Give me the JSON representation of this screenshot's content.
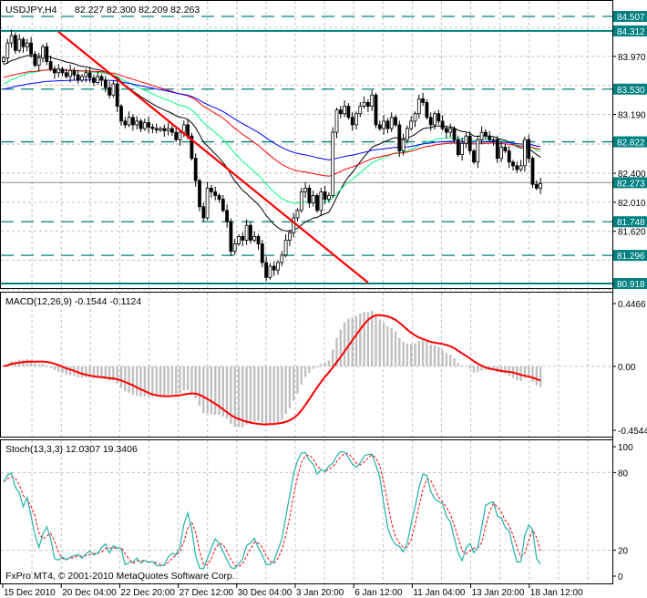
{
  "chart_data": [
    {
      "type": "candlestick",
      "title": "USDJPY,H4",
      "header_values": "82.227 82.300 82.209 82.263",
      "ylim": [
        80.8,
        84.62
      ],
      "closes": [
        83.95,
        84.15,
        84.25,
        84.05,
        84.2,
        84.1,
        84.15,
        84.0,
        83.85,
        83.95,
        84.1,
        83.9,
        83.8,
        83.75,
        83.8,
        83.75,
        83.7,
        83.78,
        83.72,
        83.65,
        83.7,
        83.75,
        83.68,
        83.62,
        83.7,
        83.65,
        83.55,
        83.45,
        83.6,
        83.3,
        83.1,
        83.05,
        83.15,
        83.05,
        83.1,
        83.0,
        83.08,
        83.02,
        83.0,
        82.98,
        83.0,
        82.97,
        83.0,
        82.95,
        82.85,
        82.95,
        83.05,
        82.9,
        82.6,
        82.3,
        81.95,
        81.8,
        82.2,
        82.15,
        82.1,
        82.05,
        81.9,
        81.75,
        81.35,
        81.45,
        81.55,
        81.5,
        81.7,
        81.5,
        81.55,
        81.45,
        81.2,
        81.0,
        81.15,
        81.1,
        81.2,
        81.3,
        81.5,
        81.6,
        81.8,
        81.9,
        82.15,
        82.2,
        82.0,
        82.1,
        81.9,
        82.15,
        82.05,
        82.1,
        82.95,
        83.25,
        83.2,
        83.3,
        83.15,
        83.05,
        83.2,
        83.3,
        83.35,
        83.3,
        83.45,
        83.05,
        83.0,
        83.1,
        83.0,
        83.15,
        83.05,
        82.7,
        82.85,
        83.0,
        83.1,
        83.2,
        83.4,
        83.35,
        83.15,
        83.05,
        83.2,
        83.1,
        83.0,
        82.95,
        83.0,
        82.85,
        82.65,
        82.8,
        82.9,
        82.7,
        82.55,
        82.85,
        82.95,
        82.9,
        82.85,
        82.85,
        82.6,
        82.75,
        82.7,
        82.55,
        82.5,
        82.45,
        82.5,
        82.85,
        82.6,
        82.25,
        82.2,
        82.26
      ],
      "first_open": 83.9,
      "moving_averages": [
        {
          "color": "#000000",
          "period": 22,
          "seed": 83.85
        },
        {
          "color": "#00ff7f",
          "period": 40,
          "seed": 83.58
        },
        {
          "color": "#ff0000",
          "period": 70,
          "seed": 83.68
        },
        {
          "color": "#0000ff",
          "period": 100,
          "seed": 83.52
        }
      ],
      "trendline": {
        "color": "#ff0000",
        "from": {
          "bar": 14,
          "price": 84.3
        },
        "to": {
          "bar": 93,
          "price": 80.93
        }
      },
      "levels": [
        {
          "price": "84.507",
          "style": "dashed",
          "color": "#008080"
        },
        {
          "price": "84.312",
          "style": "solid",
          "color": "#008080"
        },
        {
          "price": "83.530",
          "style": "dashed",
          "color": "#008080"
        },
        {
          "price": "82.822",
          "style": "dashed",
          "color": "#008080"
        },
        {
          "price": "82.273",
          "style": "current",
          "color": "#a0a0a0"
        },
        {
          "price": "81.748",
          "style": "dashed",
          "color": "#008080"
        },
        {
          "price": "81.296",
          "style": "dashed",
          "color": "#008080"
        },
        {
          "price": "80.918",
          "style": "solid",
          "color": "#008080"
        }
      ],
      "y_ticks": [
        "83.970",
        "83.190",
        "82.400",
        "82.010",
        "81.620"
      ],
      "grid_prices": [
        84.36,
        83.97,
        83.58,
        83.19,
        82.79,
        82.4,
        82.01,
        81.62,
        81.23,
        80.84
      ]
    },
    {
      "type": "bar+line",
      "title": "MACD(12,26,9) -0.1544 -0.1124",
      "fast": 12,
      "slow": 26,
      "signal": 9,
      "ylim": [
        -0.4544,
        0.4466
      ],
      "y_ticks": [
        "0.4466",
        "0.00",
        "-0.4544"
      ],
      "histogram_color": "#c0c0c0",
      "signal_color": "#ff0000"
    },
    {
      "type": "line",
      "title": "Stoch(13,3,3) 12.0307 19.3406",
      "k": 13,
      "d": 3,
      "slowing": 3,
      "ylim": [
        0,
        100
      ],
      "y_ticks": [
        "100",
        "80",
        "20",
        "0"
      ],
      "main_color": "#20b2aa",
      "signal_color": "#ff0000"
    }
  ],
  "x_ticks": [
    "15 Dec 2010",
    "20 Dec 04:00",
    "22 Dec 20:00",
    "27 Dec 12:00",
    "30 Dec 04:00",
    "3 Jan 20:00",
    "6 Jan 12:00",
    "11 Jan 04:00",
    "13 Jan 20:00",
    "18 Jan 12:00"
  ],
  "copyright": "FxPro MT4, © 2001-2010 MetaQuotes Software Corp."
}
